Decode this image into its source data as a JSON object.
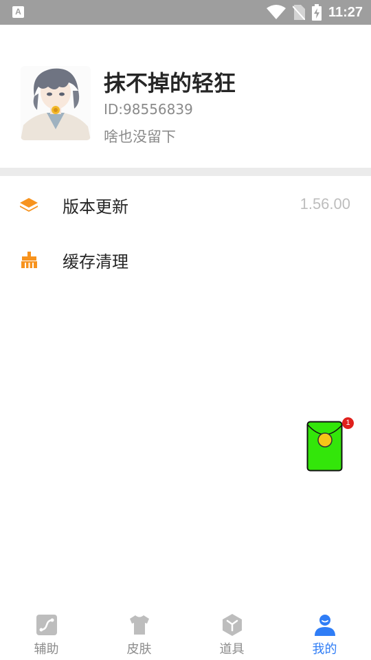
{
  "status_bar": {
    "left_icon": "A",
    "time": "11:27",
    "icons": [
      "wifi-icon",
      "no-sim-icon",
      "battery-charging-icon"
    ]
  },
  "profile": {
    "nickname": "抹不掉的轻狂",
    "user_id": "ID:98556839",
    "bio": "啥也没留下"
  },
  "menu": [
    {
      "icon": "layers-icon",
      "label": "版本更新",
      "value": "1.56.00"
    },
    {
      "icon": "broom-icon",
      "label": "缓存清理",
      "value": ""
    }
  ],
  "floating": {
    "badge": "1",
    "icon": "red-packet-icon"
  },
  "bottom_nav": [
    {
      "icon": "assist-icon",
      "label": "辅助",
      "active": false
    },
    {
      "icon": "shirt-icon",
      "label": "皮肤",
      "active": false
    },
    {
      "icon": "box-icon",
      "label": "道具",
      "active": false
    },
    {
      "icon": "person-icon",
      "label": "我的",
      "active": true
    }
  ],
  "colors": {
    "accent_orange": "#f7931e",
    "active_blue": "#2f7df6",
    "inactive_gray": "#8c8c8c",
    "red_packet_green": "#33e60a",
    "status_bar": "#9e9e9e"
  }
}
